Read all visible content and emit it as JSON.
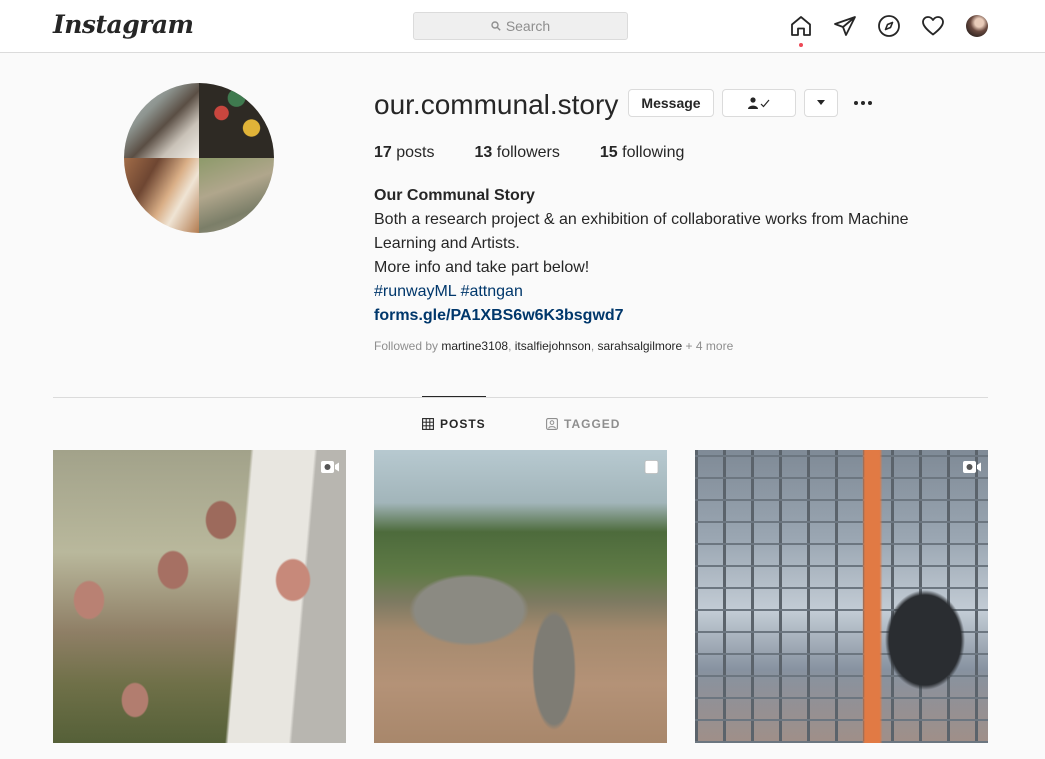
{
  "nav": {
    "logo_text": "Instagram",
    "search_placeholder": "Search",
    "icons": [
      "home-icon",
      "direct-icon",
      "explore-icon",
      "activity-heart-icon",
      "profile-avatar"
    ],
    "notification_dot_color": "#ed4956"
  },
  "profile": {
    "username": "our.communal.story",
    "buttons": {
      "message": "Message",
      "following_icon": "person-check-icon",
      "dropdown_icon": "caret-down-icon",
      "more_icon": "more-options-icon"
    },
    "stats": {
      "posts_count": "17",
      "posts_label": "posts",
      "followers_count": "13",
      "followers_label": "followers",
      "following_count": "15",
      "following_label": "following"
    },
    "bio": {
      "name": "Our Communal Story",
      "line1": "Both a research project & an exhibition of collaborative works from Machine Learning and Artists.",
      "line2": "More info and take part below!",
      "hashtag1": "#runwayML",
      "hashtag2": "#attngan",
      "link": "forms.gle/PA1XBS6w6K3bsgwd7"
    },
    "followed_by": {
      "prefix": "Followed by",
      "user1": "martine3108",
      "user2": "itsalfiejohnson",
      "user3": "sarahsalgilmore",
      "more": "+ 4 more"
    }
  },
  "tabs": {
    "posts": "POSTS",
    "tagged": "TAGGED",
    "active": "posts"
  },
  "posts": [
    {
      "type": "video",
      "badge_icon": "video-icon"
    },
    {
      "type": "photo",
      "badge_icon": "single-photo-icon"
    },
    {
      "type": "video",
      "badge_icon": "video-icon"
    }
  ],
  "colors": {
    "link": "#00376b",
    "muted": "#8e8e8e",
    "border": "#dbdbdb",
    "text": "#262626"
  }
}
